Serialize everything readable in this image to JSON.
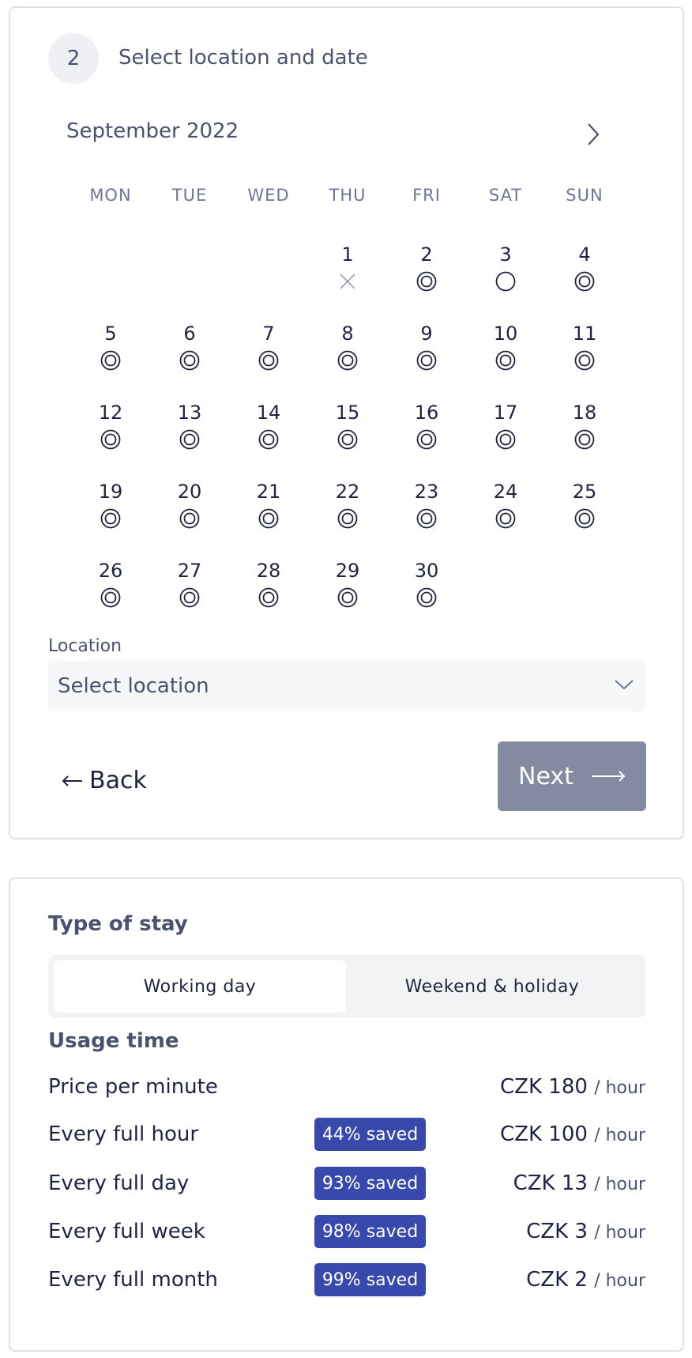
{
  "step": {
    "number": "2",
    "title": "Select location and date"
  },
  "calendar": {
    "month_label": "September 2022",
    "weekdays": [
      "MON",
      "TUE",
      "WED",
      "THU",
      "FRI",
      "SAT",
      "SUN"
    ],
    "first_weekday_index": 3,
    "days": [
      {
        "n": "1",
        "state": "unavailable"
      },
      {
        "n": "2",
        "state": "available"
      },
      {
        "n": "3",
        "state": "limited"
      },
      {
        "n": "4",
        "state": "available"
      },
      {
        "n": "5",
        "state": "available"
      },
      {
        "n": "6",
        "state": "available"
      },
      {
        "n": "7",
        "state": "available"
      },
      {
        "n": "8",
        "state": "available"
      },
      {
        "n": "9",
        "state": "available"
      },
      {
        "n": "10",
        "state": "available"
      },
      {
        "n": "11",
        "state": "available"
      },
      {
        "n": "12",
        "state": "available"
      },
      {
        "n": "13",
        "state": "available"
      },
      {
        "n": "14",
        "state": "available"
      },
      {
        "n": "15",
        "state": "available"
      },
      {
        "n": "16",
        "state": "available"
      },
      {
        "n": "17",
        "state": "available"
      },
      {
        "n": "18",
        "state": "available"
      },
      {
        "n": "19",
        "state": "available"
      },
      {
        "n": "20",
        "state": "available"
      },
      {
        "n": "21",
        "state": "available"
      },
      {
        "n": "22",
        "state": "available"
      },
      {
        "n": "23",
        "state": "available"
      },
      {
        "n": "24",
        "state": "available"
      },
      {
        "n": "25",
        "state": "available"
      },
      {
        "n": "26",
        "state": "available"
      },
      {
        "n": "27",
        "state": "available"
      },
      {
        "n": "28",
        "state": "available"
      },
      {
        "n": "29",
        "state": "available"
      },
      {
        "n": "30",
        "state": "available"
      }
    ]
  },
  "location": {
    "label": "Location",
    "placeholder": "Select location"
  },
  "nav": {
    "back_label": "Back",
    "next_label": "Next"
  },
  "stay_type": {
    "heading": "Type of stay",
    "options": [
      "Working day",
      "Weekend & holiday"
    ],
    "selected": "Working day"
  },
  "usage": {
    "heading": "Usage time",
    "unit": "/ hour",
    "rows": [
      {
        "label": "Price per minute",
        "badge": "",
        "price": "CZK 180"
      },
      {
        "label": "Every full hour",
        "badge": "44% saved",
        "price": "CZK 100"
      },
      {
        "label": "Every full day",
        "badge": "93% saved",
        "price": "CZK 13"
      },
      {
        "label": "Every full week",
        "badge": "98% saved",
        "price": "CZK 3"
      },
      {
        "label": "Every full month",
        "badge": "99% saved",
        "price": "CZK 2"
      }
    ]
  },
  "colors": {
    "accent_badge": "#3949ab",
    "next_button": "#848aa0",
    "text": "#1f2440",
    "muted": "#4a5270"
  },
  "icons": {
    "next_month": "chevron-right-icon",
    "dropdown": "chevron-down-icon",
    "back": "arrow-left-icon",
    "next": "arrow-right-icon"
  }
}
